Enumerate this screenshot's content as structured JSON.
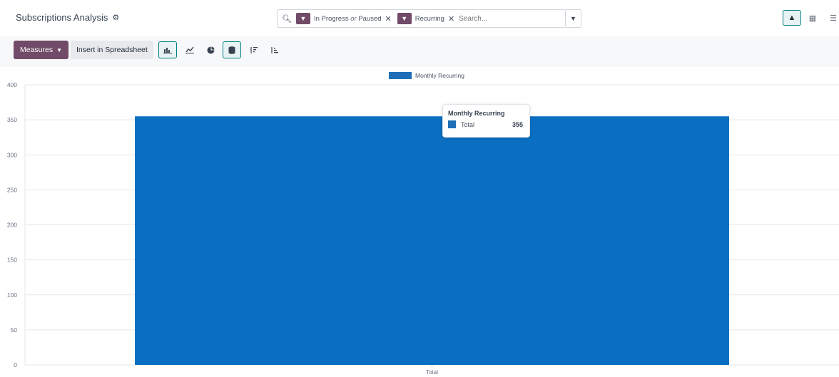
{
  "header": {
    "title": "Subscriptions Analysis",
    "gear_icon": "gear-icon"
  },
  "search": {
    "facets": [
      {
        "icon": "filter-icon",
        "value_a": "In Progress",
        "joiner": "or",
        "value_b": "Paused"
      },
      {
        "icon": "filter-icon",
        "value_a": "Recurring"
      }
    ],
    "placeholder": "Search...",
    "dropdown_icon": "caret-down-icon"
  },
  "views": [
    {
      "icon": "area-chart-icon",
      "active": true
    },
    {
      "icon": "pivot-grid-icon",
      "active": false
    },
    {
      "icon": "list-icon",
      "active": false
    }
  ],
  "toolbar": {
    "measures_label": "Measures",
    "insert_label": "Insert in Spreadsheet",
    "icons": [
      "bar-chart-icon",
      "line-chart-icon",
      "pie-chart-icon",
      "stacked-icon",
      "sort-descending-icon",
      "sort-ascending-icon"
    ]
  },
  "tooltip": {
    "title": "Monthly Recurring",
    "label": "Total",
    "value": "355"
  },
  "colors": {
    "brand": "#714b67",
    "accent": "#017e84",
    "bar": "#1f6fb8"
  },
  "chart_data": {
    "type": "bar",
    "categories": [
      "Total"
    ],
    "series": [
      {
        "name": "Monthly Recurring",
        "values": [
          355
        ]
      }
    ],
    "title": "",
    "xlabel": "",
    "ylabel": "",
    "ylim": [
      0,
      400
    ],
    "yticks": [
      0,
      50,
      100,
      150,
      200,
      250,
      300,
      350,
      400
    ],
    "grid": true,
    "legend": "top-center"
  }
}
